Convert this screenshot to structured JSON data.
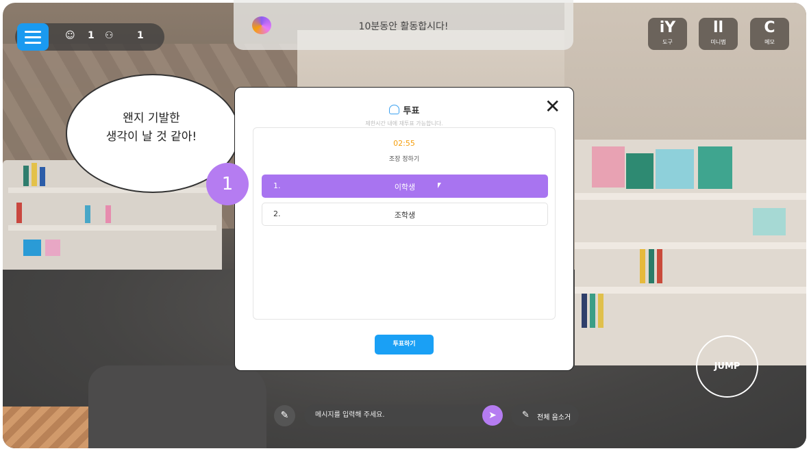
{
  "hud": {
    "user_count": "1",
    "group_count": "1"
  },
  "banner": {
    "message": "10분동안 활동합시다!"
  },
  "tools": [
    {
      "glyph": "iY",
      "label": "도구"
    },
    {
      "glyph": "ll",
      "label": "미니맵"
    },
    {
      "glyph": "C",
      "label": "메모"
    }
  ],
  "bubble": {
    "line1": "왠지 기발한",
    "line2": "생각이 날 것 같아!"
  },
  "modal": {
    "title": "투표",
    "subtitle": "제한시간 내에 재투표 가능합니다.",
    "timer": "02:55",
    "question": "조장 정하기",
    "options": [
      {
        "num": "1.",
        "label": "이학생",
        "selected": true
      },
      {
        "num": "2.",
        "label": "조학생",
        "selected": false
      }
    ],
    "vote_button": "투표하기",
    "close_glyph": "✕"
  },
  "step_badge": "1",
  "chat": {
    "placeholder": "메시지를 입력해 주세요."
  },
  "mute_all": "전체 음소거",
  "jump_label": "JUMP",
  "colors": {
    "accent_blue": "#1aa0f5",
    "accent_purple": "#a874f0",
    "timer_orange": "#f59e0b"
  }
}
